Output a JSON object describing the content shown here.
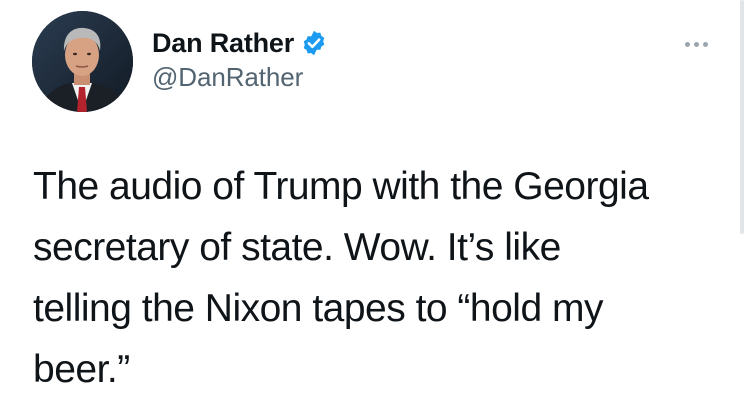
{
  "author": {
    "display_name": "Dan Rather",
    "handle": "@DanRather",
    "verified": true,
    "verified_badge_color": "#1d9bf0"
  },
  "avatar": {
    "icon": "profile-photo-avatar"
  },
  "more_menu": {
    "icon": "more-options-icon"
  },
  "tweet": {
    "text_lines": [
      "The audio of Trump with the Georgia",
      "secretary of state. Wow. It’s like",
      "telling the Nixon tapes to “hold my",
      "beer.”"
    ]
  },
  "colors": {
    "text_primary": "#0f1419",
    "text_secondary": "#536471",
    "background": "#ffffff"
  }
}
